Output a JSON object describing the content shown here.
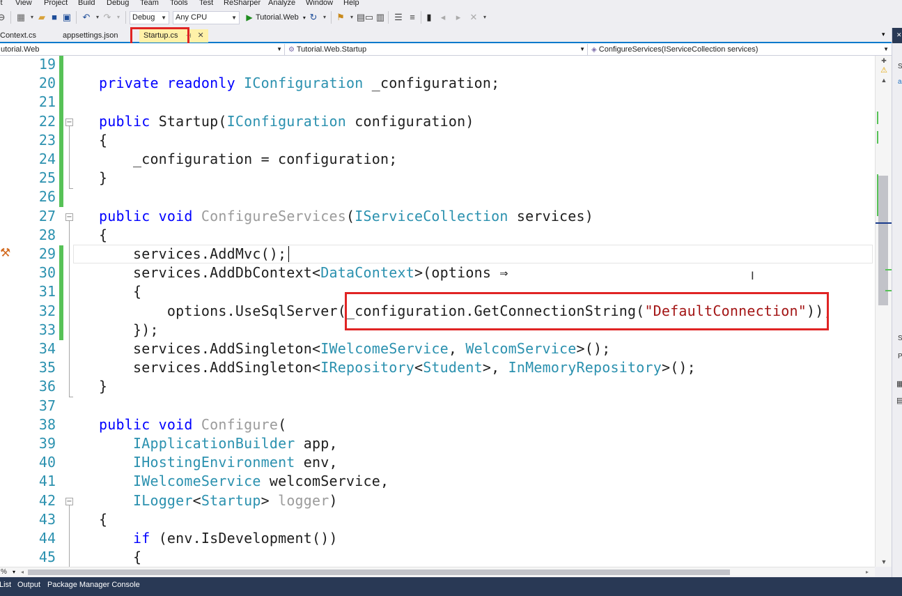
{
  "menu": {
    "items": [
      "it",
      "View",
      "Project",
      "Build",
      "Debug",
      "Team",
      "Tools",
      "Test",
      "ReSharper",
      "Analyze",
      "Window",
      "Help"
    ]
  },
  "toolbar": {
    "config_value": "Debug",
    "platform_value": "Any CPU",
    "run_target": "Tutorial.Web"
  },
  "tabs": {
    "items": [
      "Context.cs",
      "appsettings.json",
      "Startup.cs"
    ],
    "active": "Startup.cs",
    "pin_glyph": "⊣",
    "close_glyph": "✕"
  },
  "navbar": {
    "project": "utorial.Web",
    "type": "Tutorial.Web.Startup",
    "member": "ConfigureServices(IServiceCollection services)"
  },
  "editor": {
    "lines": [
      {
        "n": "19",
        "tokens": []
      },
      {
        "n": "20",
        "tokens": [
          {
            "c": "kw",
            "t": "private readonly "
          },
          {
            "c": "ty",
            "t": "IConfiguration"
          },
          {
            "c": "",
            "t": " _configuration;"
          }
        ]
      },
      {
        "n": "21",
        "tokens": []
      },
      {
        "n": "22",
        "tokens": [
          {
            "c": "kw",
            "t": "public "
          },
          {
            "c": "",
            "t": "Startup("
          },
          {
            "c": "ty",
            "t": "IConfiguration"
          },
          {
            "c": "",
            "t": " configuration)"
          }
        ]
      },
      {
        "n": "23",
        "tokens": [
          {
            "c": "",
            "t": "{"
          }
        ]
      },
      {
        "n": "24",
        "tokens": [
          {
            "c": "",
            "t": "    _configuration = configuration;"
          }
        ]
      },
      {
        "n": "25",
        "tokens": [
          {
            "c": "",
            "t": "}"
          }
        ]
      },
      {
        "n": "26",
        "tokens": []
      },
      {
        "n": "27",
        "tokens": [
          {
            "c": "kw",
            "t": "public void "
          },
          {
            "c": "gr",
            "t": "ConfigureServices"
          },
          {
            "c": "",
            "t": "("
          },
          {
            "c": "ty",
            "t": "IServiceCollection"
          },
          {
            "c": "",
            "t": " services)"
          }
        ]
      },
      {
        "n": "28",
        "tokens": [
          {
            "c": "",
            "t": "{"
          }
        ]
      },
      {
        "n": "29",
        "tokens": [
          {
            "c": "",
            "t": "    services.AddMvc();"
          }
        ]
      },
      {
        "n": "30",
        "tokens": [
          {
            "c": "",
            "t": "    services.AddDbContext<"
          },
          {
            "c": "ty",
            "t": "DataContext"
          },
          {
            "c": "",
            "t": ">(options ⇒"
          }
        ]
      },
      {
        "n": "31",
        "tokens": [
          {
            "c": "",
            "t": "    {"
          }
        ]
      },
      {
        "n": "32",
        "tokens": [
          {
            "c": "",
            "t": "        options.UseSqlServer(_configuration.GetConnectionString("
          },
          {
            "c": "st",
            "t": "\"DefaultConnection\""
          },
          {
            "c": "",
            "t": "));"
          }
        ]
      },
      {
        "n": "33",
        "tokens": [
          {
            "c": "",
            "t": "    });"
          }
        ]
      },
      {
        "n": "34",
        "tokens": [
          {
            "c": "",
            "t": "    services.AddSingleton<"
          },
          {
            "c": "ty",
            "t": "IWelcomeService"
          },
          {
            "c": "",
            "t": ", "
          },
          {
            "c": "ty",
            "t": "WelcomService"
          },
          {
            "c": "",
            "t": ">();"
          }
        ]
      },
      {
        "n": "35",
        "tokens": [
          {
            "c": "",
            "t": "    services.AddSingleton<"
          },
          {
            "c": "ty",
            "t": "IRepository"
          },
          {
            "c": "",
            "t": "<"
          },
          {
            "c": "ty",
            "t": "Student"
          },
          {
            "c": "",
            "t": ">, "
          },
          {
            "c": "ty",
            "t": "InMemoryRepository"
          },
          {
            "c": "",
            "t": ">();"
          }
        ]
      },
      {
        "n": "36",
        "tokens": [
          {
            "c": "",
            "t": "}"
          }
        ]
      },
      {
        "n": "37",
        "tokens": []
      },
      {
        "n": "38",
        "tokens": [
          {
            "c": "kw",
            "t": "public void "
          },
          {
            "c": "gr",
            "t": "Configure"
          },
          {
            "c": "",
            "t": "("
          }
        ]
      },
      {
        "n": "39",
        "tokens": [
          {
            "c": "",
            "t": "    "
          },
          {
            "c": "ty",
            "t": "IApplicationBuilder"
          },
          {
            "c": "",
            "t": " app,"
          }
        ]
      },
      {
        "n": "40",
        "tokens": [
          {
            "c": "",
            "t": "    "
          },
          {
            "c": "ty",
            "t": "IHostingEnvironment"
          },
          {
            "c": "",
            "t": " env,"
          }
        ]
      },
      {
        "n": "41",
        "tokens": [
          {
            "c": "",
            "t": "    "
          },
          {
            "c": "ty",
            "t": "IWelcomeService"
          },
          {
            "c": "",
            "t": " welcomService,"
          }
        ]
      },
      {
        "n": "42",
        "tokens": [
          {
            "c": "",
            "t": "    "
          },
          {
            "c": "ty",
            "t": "ILogger"
          },
          {
            "c": "",
            "t": "<"
          },
          {
            "c": "ty",
            "t": "Startup"
          },
          {
            "c": "",
            "t": "> "
          },
          {
            "c": "gr",
            "t": "logger"
          },
          {
            "c": "",
            "t": ")"
          }
        ]
      },
      {
        "n": "43",
        "tokens": [
          {
            "c": "",
            "t": "{"
          }
        ]
      },
      {
        "n": "44",
        "tokens": [
          {
            "c": "",
            "t": "    "
          },
          {
            "c": "kw",
            "t": "if"
          },
          {
            "c": "",
            "t": " (env.IsDevelopment())"
          }
        ]
      },
      {
        "n": "45",
        "tokens": [
          {
            "c": "",
            "t": "    {"
          }
        ]
      }
    ]
  },
  "statusbar": {
    "zoom": "%"
  },
  "bottom_tabs": [
    "List",
    "Output",
    "Package Manager Console"
  ],
  "right_panel": {
    "labels": [
      "S",
      "a",
      "S",
      "P"
    ]
  },
  "colors": {
    "keyword": "#0000ff",
    "type": "#2b91af",
    "string": "#a31515",
    "line_number": "#2b91af",
    "highlight_box": "#e02424",
    "change_bar": "#57c257",
    "active_tab": "#fff1a8",
    "accent": "#007acc"
  },
  "icons": [
    "new-project-icon",
    "open-icon",
    "save-icon",
    "save-all-icon",
    "undo-icon",
    "redo-icon",
    "play-icon",
    "refresh-icon",
    "hammer-icon",
    "bookmark-icon",
    "comment-icon",
    "uncomment-icon",
    "indent-icon"
  ]
}
